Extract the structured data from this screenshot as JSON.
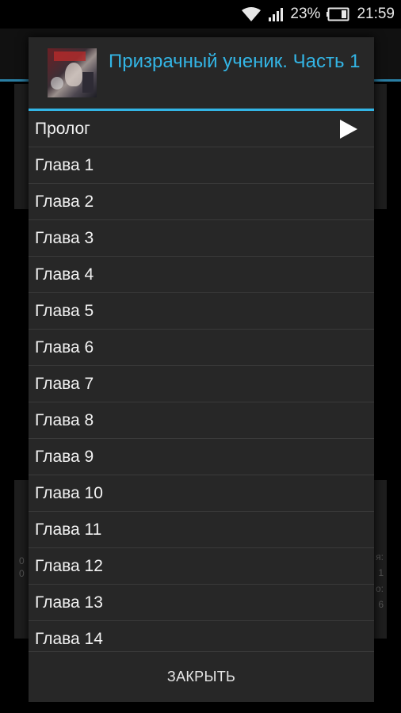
{
  "status_bar": {
    "battery_percent": "23%",
    "time": "21:59",
    "icons": [
      "wifi-icon",
      "signal-icon",
      "battery-icon"
    ]
  },
  "background": {
    "left_text": [
      "0",
      "0"
    ],
    "right_text": [
      "я:",
      "1",
      "о:",
      "6"
    ]
  },
  "dialog": {
    "title": "Призрачный ученик. Часть 1",
    "chapters": [
      {
        "label": "Пролог",
        "playing": true
      },
      {
        "label": "Глава 1"
      },
      {
        "label": "Глава 2"
      },
      {
        "label": "Глава 3"
      },
      {
        "label": "Глава 4"
      },
      {
        "label": "Глава 5"
      },
      {
        "label": "Глава 6"
      },
      {
        "label": "Глава 7"
      },
      {
        "label": "Глава 8"
      },
      {
        "label": "Глава 9"
      },
      {
        "label": "Глава 10"
      },
      {
        "label": "Глава 11"
      },
      {
        "label": "Глава 12"
      },
      {
        "label": "Глава 13"
      },
      {
        "label": "Глава 14"
      }
    ],
    "close_label": "ЗАКРЫТЬ",
    "play_icon": "play-icon",
    "accent_color": "#33b5e5"
  }
}
